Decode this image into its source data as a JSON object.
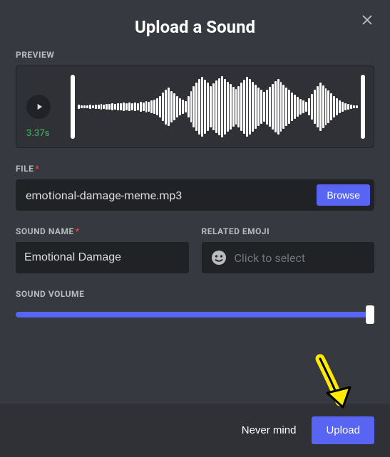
{
  "header": {
    "title": "Upload a Sound"
  },
  "preview": {
    "label": "PREVIEW",
    "duration": "3.37s"
  },
  "file": {
    "label": "FILE",
    "name": "emotional-damage-meme.mp3",
    "browse": "Browse"
  },
  "soundName": {
    "label": "SOUND NAME",
    "value": "Emotional Damage"
  },
  "relatedEmoji": {
    "label": "RELATED EMOJI",
    "placeholder": "Click to select"
  },
  "volume": {
    "label": "SOUND VOLUME"
  },
  "footer": {
    "cancel": "Never mind",
    "confirm": "Upload"
  }
}
